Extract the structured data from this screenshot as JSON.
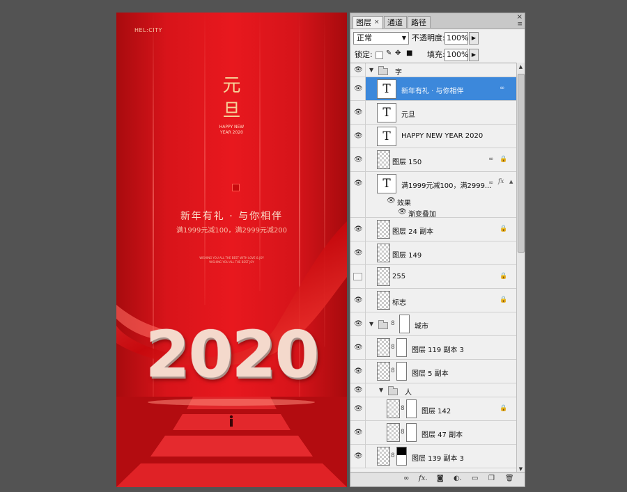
{
  "poster": {
    "brand": "HEL:CITY",
    "title_chars": [
      "元",
      "旦"
    ],
    "subtitle_line1": "HAPPY NEW",
    "subtitle_line2": "YEAR 2020",
    "slogan": "新年有礼 · 与你相伴",
    "promo": "满1999元减100，满2999元减200",
    "fine_print_line1": "WISHING YOU ALL THE BEST WITH LOVE & JOY",
    "fine_print_line2": "WISHING YOU ALL THE BEST JOY",
    "year": "2020"
  },
  "panel": {
    "tabs": [
      "图层",
      "通道",
      "路径"
    ],
    "tab_close": "×",
    "close_glyph": "×",
    "menu_glyph": "≡",
    "blend_mode": "正常",
    "opacity_label": "不透明度:",
    "opacity_value": "100%",
    "lock_label": "锁定:",
    "fill_label": "填充:",
    "fill_value": "100%",
    "layers": [
      {
        "name": "字",
        "kind": "group",
        "visible": true
      },
      {
        "name": "新年有礼 · 与你相伴",
        "kind": "text",
        "visible": true,
        "selected": true,
        "right_icon": "link-icon"
      },
      {
        "name": "元旦",
        "kind": "text",
        "visible": true
      },
      {
        "name": "HAPPY NEW YEAR 2020",
        "kind": "text",
        "visible": true
      },
      {
        "name": "图层 150",
        "kind": "pixel",
        "visible": true,
        "right_icon": "link-lock-icon"
      },
      {
        "name": "满1999元减100，满2999...",
        "kind": "text",
        "visible": true,
        "right_icon": "fx-icon"
      },
      {
        "name": "效果",
        "kind": "effect",
        "visible": true
      },
      {
        "name": "渐变叠加",
        "kind": "effect-item",
        "visible": true
      },
      {
        "name": "图层 24 副本",
        "kind": "pixel",
        "visible": true,
        "right_icon": "lock-icon"
      },
      {
        "name": "图层 149",
        "kind": "pixel",
        "visible": true
      },
      {
        "name": "255",
        "kind": "pixel",
        "visible": false,
        "right_icon": "lock-icon"
      },
      {
        "name": "标志",
        "kind": "pixel",
        "visible": true,
        "right_icon": "lock-icon"
      },
      {
        "name": "城市",
        "kind": "group-mask",
        "visible": true
      },
      {
        "name": "图层 119 副本 3",
        "kind": "pixel-mask",
        "visible": true
      },
      {
        "name": "图层 5 副本",
        "kind": "pixel-mask",
        "visible": true
      },
      {
        "name": "人",
        "kind": "subgroup",
        "visible": true
      },
      {
        "name": "图层 142",
        "kind": "pixel-mask",
        "visible": true,
        "right_icon": "lock-icon"
      },
      {
        "name": "图层 47 副本",
        "kind": "pixel-mask",
        "visible": true
      },
      {
        "name": "图层 139 副本 3",
        "kind": "pixel-mask",
        "visible": true
      }
    ]
  },
  "colors": {
    "poster_red": "#e8181e",
    "selection_blue": "#3c88db",
    "panel_bg": "#f0f0f0",
    "workspace": "#535353"
  }
}
